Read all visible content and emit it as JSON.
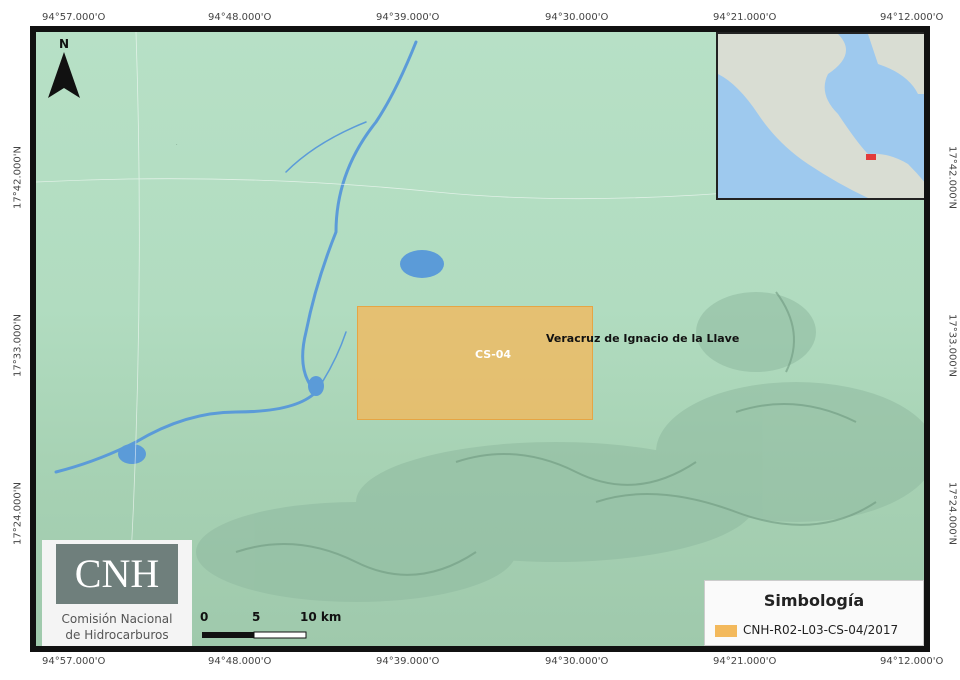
{
  "coordinates": {
    "top": [
      "94°57.000'O",
      "94°48.000'O",
      "94°39.000'O",
      "94°30.000'O",
      "94°21.000'O",
      "94°12.000'O"
    ],
    "bottom": [
      "94°57.000'O",
      "94°48.000'O",
      "94°39.000'O",
      "94°30.000'O",
      "94°21.000'O",
      "94°12.000'O"
    ],
    "left": [
      "17°42.000'N",
      "17°33.000'N",
      "17°24.000'N"
    ],
    "right": [
      "17°42.000'N",
      "17°33.000'N",
      "17°24.000'N"
    ]
  },
  "map": {
    "north_label": "N",
    "block_label": "CS-04",
    "state_label": "Veracruz de Ignacio de la Llave",
    "block_color": "#f3b95c",
    "land_color": "#b3ddc2",
    "water_color": "#5b9bd8"
  },
  "logo": {
    "abbr": "CNH",
    "line1": "Comisión Nacional",
    "line2": "de Hidrocarburos"
  },
  "scale": {
    "labels": [
      "0",
      "5",
      "10 km"
    ]
  },
  "legend": {
    "title": "Simbología",
    "items": [
      {
        "label": "CNH-R02-L03-CS-04/2017",
        "color": "#f3b95c"
      }
    ]
  }
}
